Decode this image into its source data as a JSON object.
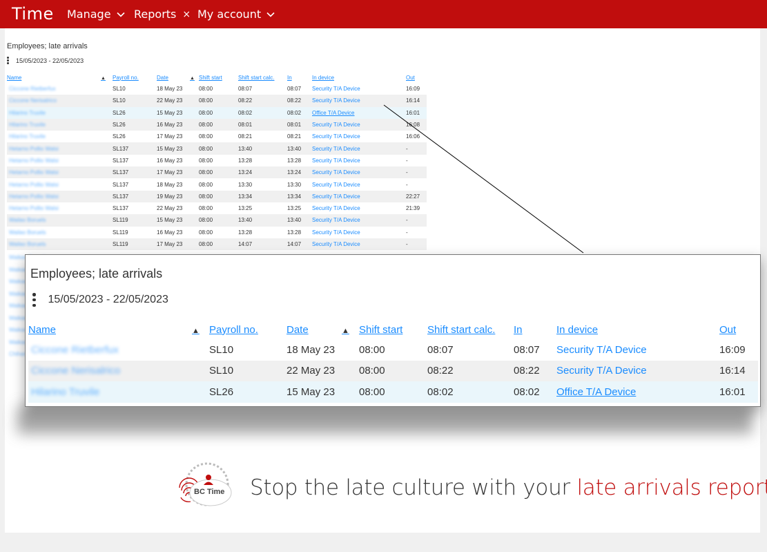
{
  "app": {
    "title": "Time"
  },
  "nav": {
    "manage": "Manage",
    "reports": "Reports",
    "my_account": "My account"
  },
  "report": {
    "title": "Employees; late arrivals",
    "range": "15/05/2023 - 22/05/2023",
    "columns": {
      "name": "Name",
      "payroll": "Payroll no.",
      "date": "Date",
      "shift_start": "Shift start",
      "shift_start_calc": "Shift start calc.",
      "in": "In",
      "in_device": "In device",
      "out": "Out"
    },
    "rows": [
      {
        "name": "Ciccone Rietberfux",
        "payroll": "SL10",
        "date": "18 May 23",
        "shift": "08:00",
        "calc": "08:07",
        "in": "08:07",
        "device": "Security T/A Device",
        "out": "16:09"
      },
      {
        "name": "Ciccone Nerisalrico",
        "payroll": "SL10",
        "date": "22 May 23",
        "shift": "08:00",
        "calc": "08:22",
        "in": "08:22",
        "device": "Security T/A Device",
        "out": "16:14"
      },
      {
        "name": "Hilarino Truvile",
        "payroll": "SL26",
        "date": "15 May 23",
        "shift": "08:00",
        "calc": "08:02",
        "in": "08:02",
        "device": "Office T/A Device",
        "out": "16:01"
      },
      {
        "name": "Hilarino Truvile",
        "payroll": "SL26",
        "date": "16 May 23",
        "shift": "08:00",
        "calc": "08:01",
        "in": "08:01",
        "device": "Security T/A Device",
        "out": "16:08"
      },
      {
        "name": "Hilarino Truvile",
        "payroll": "SL26",
        "date": "17 May 23",
        "shift": "08:00",
        "calc": "08:21",
        "in": "08:21",
        "device": "Security T/A Device",
        "out": "16:06"
      },
      {
        "name": "Hetarno Pollio Walsi",
        "payroll": "SL137",
        "date": "15 May 23",
        "shift": "08:00",
        "calc": "13:40",
        "in": "13:40",
        "device": "Security T/A Device",
        "out": "-"
      },
      {
        "name": "Hetarno Pollio Walsi",
        "payroll": "SL137",
        "date": "16 May 23",
        "shift": "08:00",
        "calc": "13:28",
        "in": "13:28",
        "device": "Security T/A Device",
        "out": "-"
      },
      {
        "name": "Hetarno Pollio Walsi",
        "payroll": "SL137",
        "date": "17 May 23",
        "shift": "08:00",
        "calc": "13:24",
        "in": "13:24",
        "device": "Security T/A Device",
        "out": "-"
      },
      {
        "name": "Hetarno Pollio Walsi",
        "payroll": "SL137",
        "date": "18 May 23",
        "shift": "08:00",
        "calc": "13:30",
        "in": "13:30",
        "device": "Security T/A Device",
        "out": "-"
      },
      {
        "name": "Hetarno Pollio Walsi",
        "payroll": "SL137",
        "date": "19 May 23",
        "shift": "08:00",
        "calc": "13:34",
        "in": "13:34",
        "device": "Security T/A Device",
        "out": "22:27"
      },
      {
        "name": "Hetarno Pollio Walsi",
        "payroll": "SL137",
        "date": "22 May 23",
        "shift": "08:00",
        "calc": "13:25",
        "in": "13:25",
        "device": "Security T/A Device",
        "out": "21:39"
      },
      {
        "name": "Wailao Boruels",
        "payroll": "SL119",
        "date": "15 May 23",
        "shift": "08:00",
        "calc": "13:40",
        "in": "13:40",
        "device": "Security T/A Device",
        "out": "-"
      },
      {
        "name": "Wailao Boruels",
        "payroll": "SL119",
        "date": "16 May 23",
        "shift": "08:00",
        "calc": "13:28",
        "in": "13:28",
        "device": "Security T/A Device",
        "out": "-"
      },
      {
        "name": "Wailao Boruels",
        "payroll": "SL119",
        "date": "17 May 23",
        "shift": "08:00",
        "calc": "14:07",
        "in": "14:07",
        "device": "Security T/A Device",
        "out": "-"
      }
    ],
    "hidden_names": [
      "Waikao Boruels",
      "Waikao Boruels",
      "Waikao Boruels",
      "Waikao Boruels",
      "Waikao Boruels",
      "Waikao Boruels",
      "Waikao Boruels",
      "Waikao Boruels",
      "Chihario"
    ]
  },
  "zoom": {
    "title": "Employees; late arrivals",
    "range": "15/05/2023 - 22/05/2023",
    "rows": [
      {
        "name": "Ciccone Rietberfux",
        "payroll": "SL10",
        "date": "18 May 23",
        "shift": "08:00",
        "calc": "08:07",
        "in": "08:07",
        "device": "Security T/A Device",
        "out": "16:09"
      },
      {
        "name": "Ciccone Nerisalrico",
        "payroll": "SL10",
        "date": "22 May 23",
        "shift": "08:00",
        "calc": "08:22",
        "in": "08:22",
        "device": "Security T/A Device",
        "out": "16:14"
      },
      {
        "name": "Hilarino Truvile",
        "payroll": "SL26",
        "date": "15 May 23",
        "shift": "08:00",
        "calc": "08:02",
        "in": "08:02",
        "device": "Office T/A Device",
        "out": "16:01"
      }
    ]
  },
  "logo": {
    "text": "BC Time"
  },
  "tagline": {
    "lead": "Stop the late culture with your ",
    "accent": "late arrivals report"
  },
  "colors": {
    "brand": "#c00d0d",
    "link": "#1a8cff"
  }
}
